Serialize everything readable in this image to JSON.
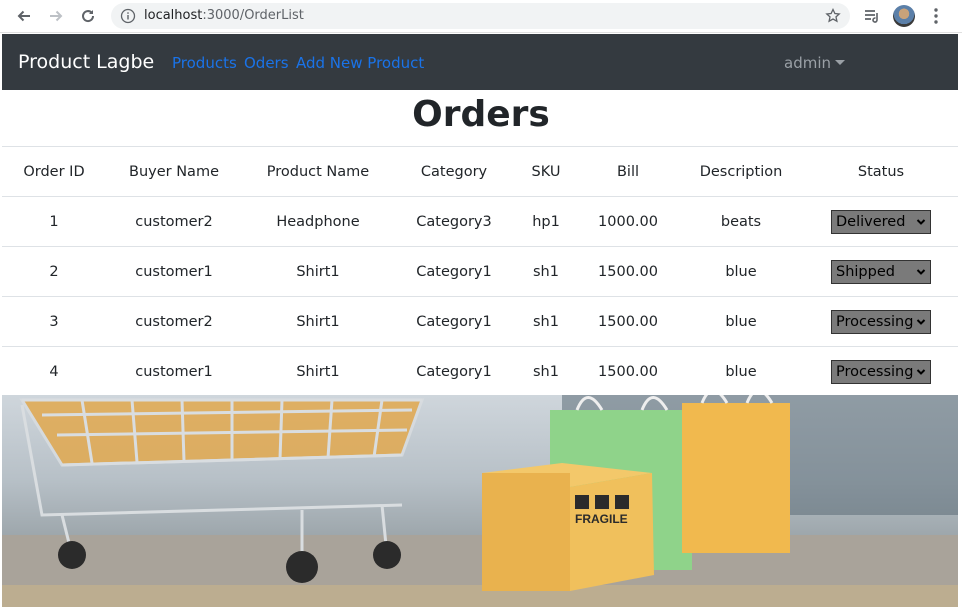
{
  "browser": {
    "url_host": "localhost",
    "url_path": ":3000/OrderList"
  },
  "navbar": {
    "brand": "Product Lagbe",
    "links": [
      "Products",
      "Oders",
      "Add New Product"
    ],
    "user": "admin"
  },
  "page": {
    "title": "Orders"
  },
  "table": {
    "headers": [
      "Order ID",
      "Buyer Name",
      "Product Name",
      "Category",
      "SKU",
      "Bill",
      "Description",
      "Status"
    ],
    "rows": [
      {
        "id": "1",
        "buyer": "customer2",
        "product": "Headphone",
        "category": "Category3",
        "sku": "hp1",
        "bill": "1000.00",
        "description": "beats",
        "status": "Delivered"
      },
      {
        "id": "2",
        "buyer": "customer1",
        "product": "Shirt1",
        "category": "Category1",
        "sku": "sh1",
        "bill": "1500.00",
        "description": "blue",
        "status": "Shipped"
      },
      {
        "id": "3",
        "buyer": "customer2",
        "product": "Shirt1",
        "category": "Category1",
        "sku": "sh1",
        "bill": "1500.00",
        "description": "blue",
        "status": "Processing"
      },
      {
        "id": "4",
        "buyer": "customer1",
        "product": "Shirt1",
        "category": "Category1",
        "sku": "sh1",
        "bill": "1500.00",
        "description": "blue",
        "status": "Processing"
      }
    ]
  },
  "hero": {
    "box_label": "FRAGILE"
  },
  "colors": {
    "navbar_bg": "#343a40",
    "link": "#1a73e8",
    "select_bg": "#7a7a7a"
  }
}
